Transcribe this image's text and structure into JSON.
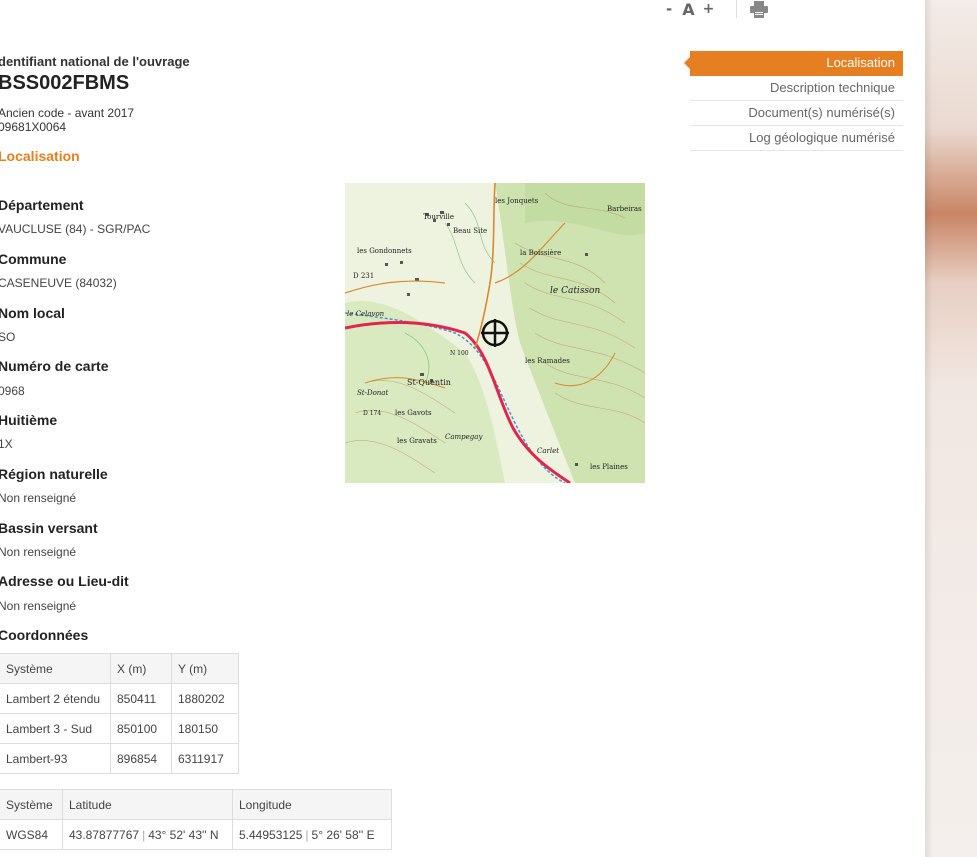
{
  "toolbar": {
    "decrease": "-",
    "font": "A",
    "increase": "+"
  },
  "header": {
    "id_label": "dentifiant national de l'ouvrage",
    "title": "BSS002FBMS",
    "old_code_label": "Ancien code - avant 2017",
    "old_code_value": "09681X0064",
    "section_title": "Localisation"
  },
  "fields": [
    {
      "label": "Département",
      "value": "VAUCLUSE (84) - SGR/PAC"
    },
    {
      "label": "Commune",
      "value": "CASENEUVE (84032)"
    },
    {
      "label": "Nom local",
      "value": "SO"
    },
    {
      "label": "Numéro de carte",
      "value": "0968"
    },
    {
      "label": "Huitième",
      "value": "1X"
    },
    {
      "label": "Région naturelle",
      "value": "Non renseigné"
    },
    {
      "label": "Bassin versant",
      "value": "Non renseigné"
    },
    {
      "label": "Adresse ou Lieu-dit",
      "value": "Non renseigné"
    }
  ],
  "coords_title": "Coordonnées",
  "coords_table": {
    "headers": [
      "Système",
      "X (m)",
      "Y (m)"
    ],
    "rows": [
      [
        "Lambert 2 étendu",
        "850411",
        "1880202"
      ],
      [
        "Lambert 3 - Sud",
        "850100",
        "180150"
      ],
      [
        "Lambert-93",
        "896854",
        "6311917"
      ]
    ]
  },
  "geo_table": {
    "headers": [
      "Système",
      "Latitude",
      "Longitude"
    ],
    "rows": [
      {
        "system": "WGS84",
        "lat": "43.87877767",
        "lat_dms": "43° 52' 43'' N",
        "lon": "5.44953125",
        "lon_dms": "5° 26' 58'' E"
      }
    ]
  },
  "map": {
    "labels": [
      "Tourville",
      "Beau Site",
      "les Jonquets",
      "Barbeiras",
      "les Gondonnets",
      "la Boissière",
      "le Catisson",
      "D 231",
      "le Celavon",
      "les Ramades",
      "St-Quentin",
      "St-Donat",
      "les Gavots",
      "les Gravats",
      "Campegay",
      "Carlet",
      "les Plaines",
      "N 100",
      "D 174"
    ],
    "colors": {
      "road_main": "#e0264a",
      "road_secondary": "#d9892e",
      "river": "#4a90d9",
      "forest": "#cfe3b0"
    }
  },
  "nav": [
    {
      "label": "Localisation",
      "active": true
    },
    {
      "label": "Description technique",
      "active": false
    },
    {
      "label": "Document(s) numérisé(s)",
      "active": false
    },
    {
      "label": "Log géologique numérisé",
      "active": false
    }
  ],
  "colors": {
    "accent": "#e67e22"
  },
  "icons": {
    "print": "print-icon",
    "target": "crosshair-icon"
  }
}
